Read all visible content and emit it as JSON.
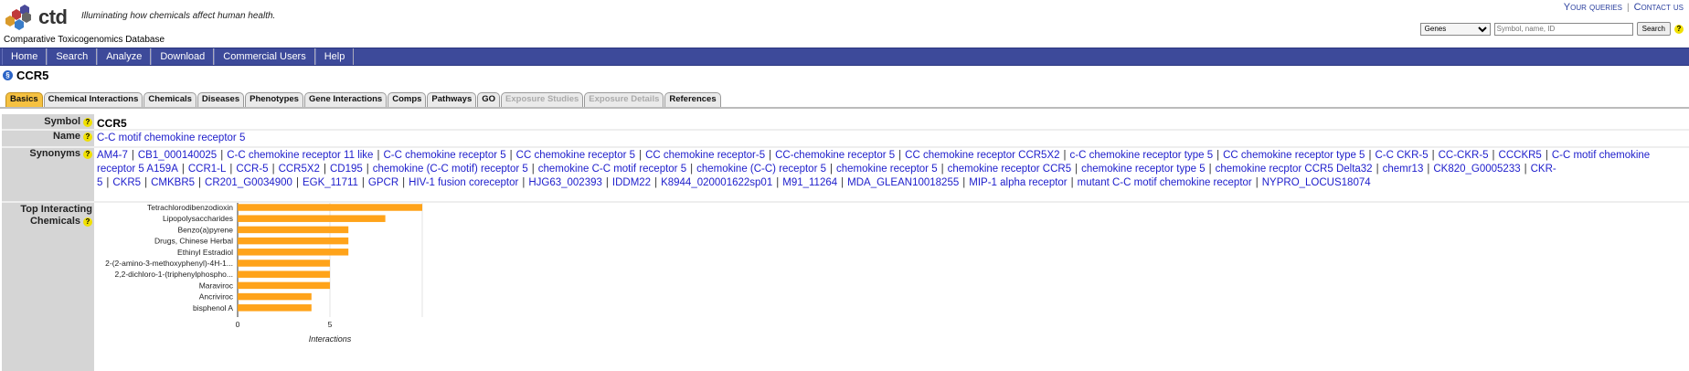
{
  "header": {
    "logo_text": "ctd",
    "tagline": "Illuminating how chemicals affect human health.",
    "db_name": "Comparative Toxicogenomics Database",
    "links": [
      "Your queries",
      "Contact us"
    ],
    "search": {
      "select_value": "Genes",
      "placeholder": "Symbol, name, ID",
      "button": "Search"
    }
  },
  "nav": [
    "Home",
    "Search",
    "Analyze",
    "Download",
    "Commercial Users",
    "Help"
  ],
  "gene": {
    "title": "CCR5"
  },
  "tabs": [
    {
      "label": "Basics",
      "state": "active"
    },
    {
      "label": "Chemical Interactions",
      "state": "normal"
    },
    {
      "label": "Chemicals",
      "state": "normal"
    },
    {
      "label": "Diseases",
      "state": "normal"
    },
    {
      "label": "Phenotypes",
      "state": "normal"
    },
    {
      "label": "Gene Interactions",
      "state": "normal"
    },
    {
      "label": "Comps",
      "state": "normal"
    },
    {
      "label": "Pathways",
      "state": "normal"
    },
    {
      "label": "GO",
      "state": "normal"
    },
    {
      "label": "Exposure Studies",
      "state": "disabled"
    },
    {
      "label": "Exposure Details",
      "state": "disabled"
    },
    {
      "label": "References",
      "state": "normal"
    }
  ],
  "labels": {
    "symbol": "Symbol",
    "name": "Name",
    "synonyms": "Synonyms",
    "top_line1": "Top Interacting",
    "top_line2": "Chemicals"
  },
  "values": {
    "symbol": "CCR5",
    "name": "C-C motif chemokine receptor 5"
  },
  "synonyms": [
    "AM4-7",
    "CB1_000140025",
    "C-C chemokine receptor 11 like",
    "C-C chemokine receptor 5",
    "CC chemokine receptor 5",
    "CC chemokine receptor-5",
    "CC-chemokine receptor 5",
    "CC chemokine receptor CCR5X2",
    "c-C chemokine receptor type 5",
    "CC chemokine receptor type 5",
    "C-C CKR-5",
    "CC-CKR-5",
    "CCCKR5",
    "C-C motif chemokine receptor 5 A159A",
    "CCR1-L",
    "CCR-5",
    "CCR5X2",
    "CD195",
    "chemokine (C-C motif) receptor 5",
    "chemokine C-C motif receptor 5",
    "chemokine (C-C) receptor 5",
    "chemokine receptor 5",
    "chemokine receptor CCR5",
    "chemokine receptor type 5",
    "chemokine recptor CCR5 Delta32",
    "chemr13",
    "CK820_G0005233",
    "CKR-5",
    "CKR5",
    "CMKBR5",
    "CR201_G0034900",
    "EGK_11711",
    "GPCR",
    "HIV-1 fusion coreceptor",
    "HJG63_002393",
    "IDDM22",
    "K8944_020001622sp01",
    "M91_11264",
    "MDA_GLEAN10018255",
    "MIP-1 alpha receptor",
    "mutant C-C motif chemokine receptor",
    "NYPRO_LOCUS18074"
  ],
  "chart_data": {
    "type": "bar",
    "orientation": "horizontal",
    "categories": [
      "Tetrachlorodibenzodioxin",
      "Lipopolysaccharides",
      "Benzo(a)pyrene",
      "Drugs, Chinese Herbal",
      "Ethinyl Estradiol",
      "2-(2-amino-3-methoxyphenyl)-4H-1...",
      "2,2-dichloro-1-(triphenylphospho...",
      "Maraviroc",
      "Ancriviroc",
      "bisphenol A"
    ],
    "values": [
      10,
      8,
      6,
      6,
      6,
      5,
      5,
      5,
      4,
      4
    ],
    "xlabel": "Interactions",
    "xticks": [
      0,
      5
    ],
    "xlim": [
      0,
      10
    ],
    "bar_color": "#ffa31a",
    "grid": true
  }
}
